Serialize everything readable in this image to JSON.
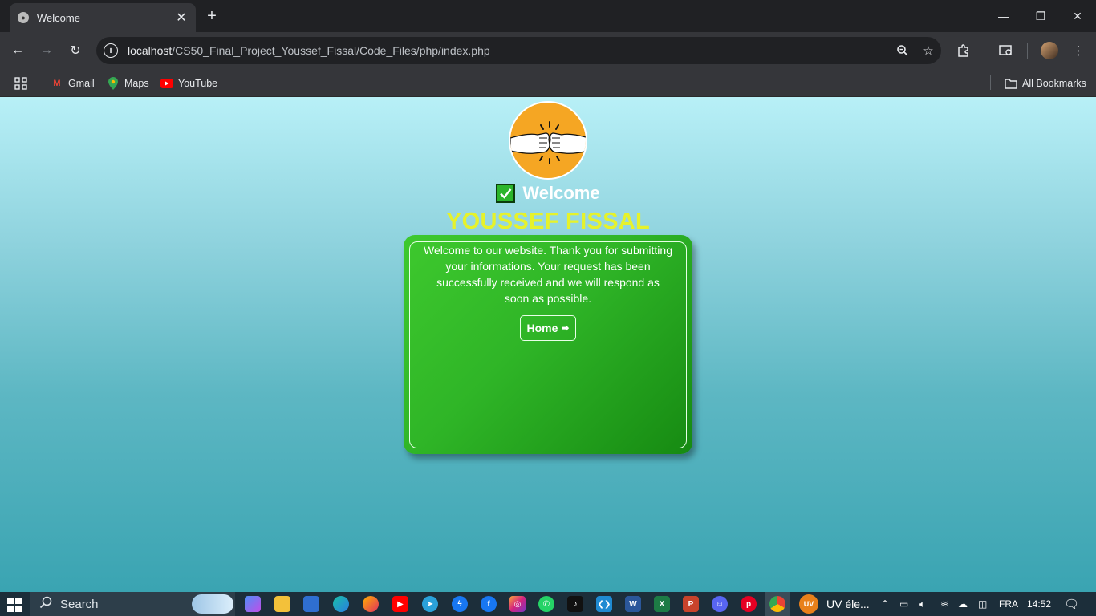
{
  "browser": {
    "tab_title": "Welcome",
    "new_tab_label": "+",
    "url_host": "localhost",
    "url_path": "/CS50_Final_Project_Youssef_Fissal/Code_Files/php/index.php"
  },
  "bookmarks": {
    "items": [
      {
        "label": "Gmail",
        "icon": "gmail-icon"
      },
      {
        "label": "Maps",
        "icon": "maps-icon"
      },
      {
        "label": "YouTube",
        "icon": "youtube-icon"
      }
    ],
    "all_bookmarks_label": "All Bookmarks"
  },
  "card": {
    "heading": "Welcome",
    "name": "YOUSSEF FISSAL",
    "message": "Welcome to our website. Thank you for submitting your informations. Your request has been successfully received and we will respond as soon as possible.",
    "home_label": "Home",
    "badge_icon": "fist-bump-icon",
    "colors": {
      "card_green": "#2fb527",
      "name_yellow": "#e6f22b",
      "badge_orange": "#f5a623"
    }
  },
  "taskbar": {
    "search_label": "Search",
    "uv_label": "UV éle...",
    "uv_icon_text": "UV",
    "language": "FRA",
    "time": "14:52"
  }
}
